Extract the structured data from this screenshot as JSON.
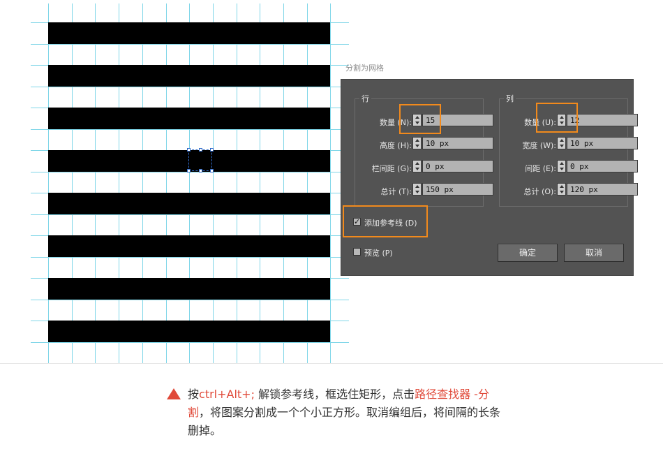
{
  "dialog": {
    "title": "分割为网格",
    "rows_group": {
      "legend": "行",
      "count_label": "数量 (N):",
      "count_value": "15",
      "height_label": "高度 (H):",
      "height_value": "10 px",
      "gutter_label": "栏间距 (G):",
      "gutter_value": "0 px",
      "total_label": "总计 (T):",
      "total_value": "150 px"
    },
    "columns_group": {
      "legend": "列",
      "count_label": "数量 (U):",
      "count_value": "12",
      "width_label": "宽度 (W):",
      "width_value": "10 px",
      "gutter_label": "间距 (E):",
      "gutter_value": "0 px",
      "total_label": "总计 (O):",
      "total_value": "120 px"
    },
    "add_guides_label": "添加参考线 (D)",
    "add_guides_checked": true,
    "add_guides_mark": "✓",
    "preview_label": "预览 (P)",
    "preview_checked": false,
    "ok_label": "确定",
    "cancel_label": "取消"
  },
  "caption": {
    "part1": "按",
    "shortcut": "ctrl+Alt+;",
    "part2": " 解锁参考线，框选住矩形，点击",
    "path_finder": "路径查找器 -分割",
    "part3": "，将图案分割成一个个小正方形。取消编组后，将间隔的长条删掉。"
  },
  "colors": {
    "accent": "#f28a1c",
    "caption_red": "#e04a3a",
    "guide": "#7fd6e8",
    "dialog_bg": "#535353"
  }
}
